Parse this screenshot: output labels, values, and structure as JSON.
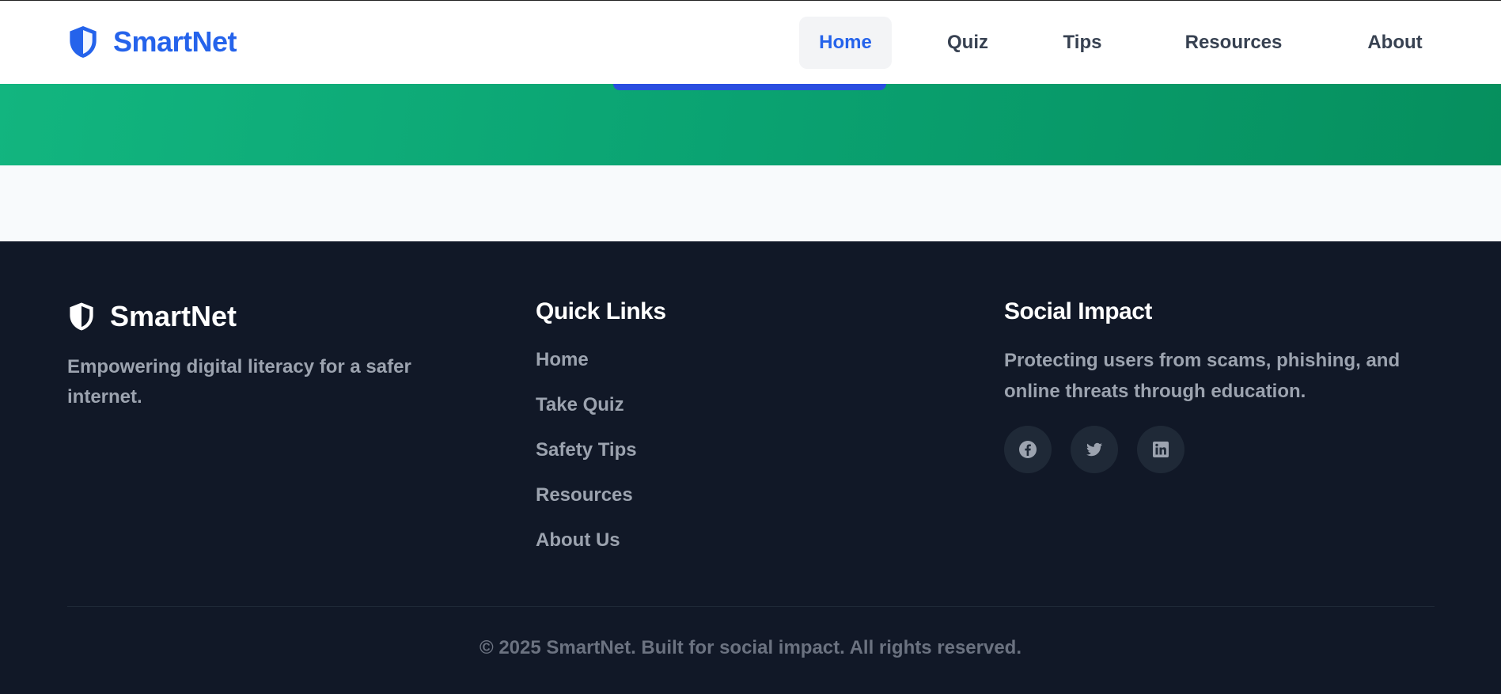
{
  "header": {
    "brand": "SmartNet",
    "nav": [
      {
        "label": "Home",
        "active": true
      },
      {
        "label": "Quiz",
        "active": false
      },
      {
        "label": "Tips",
        "active": false
      },
      {
        "label": "Resources",
        "active": false
      },
      {
        "label": "About",
        "active": false
      }
    ]
  },
  "footer": {
    "brand": "SmartNet",
    "tagline": "Empowering digital literacy for a safer internet.",
    "quick_links": {
      "title": "Quick Links",
      "items": [
        "Home",
        "Take Quiz",
        "Safety Tips",
        "Resources",
        "About Us"
      ]
    },
    "social_impact": {
      "title": "Social Impact",
      "text": "Protecting users from scams, phishing, and online threats through education.",
      "icons": [
        "facebook-icon",
        "twitter-icon",
        "linkedin-icon"
      ]
    },
    "copyright": "© 2025 SmartNet. Built for social impact. All rights reserved."
  },
  "colors": {
    "brand": "#2563eb",
    "hero_green": "#0aa271",
    "footer_bg": "#111827",
    "muted_text": "#9ca3af"
  }
}
